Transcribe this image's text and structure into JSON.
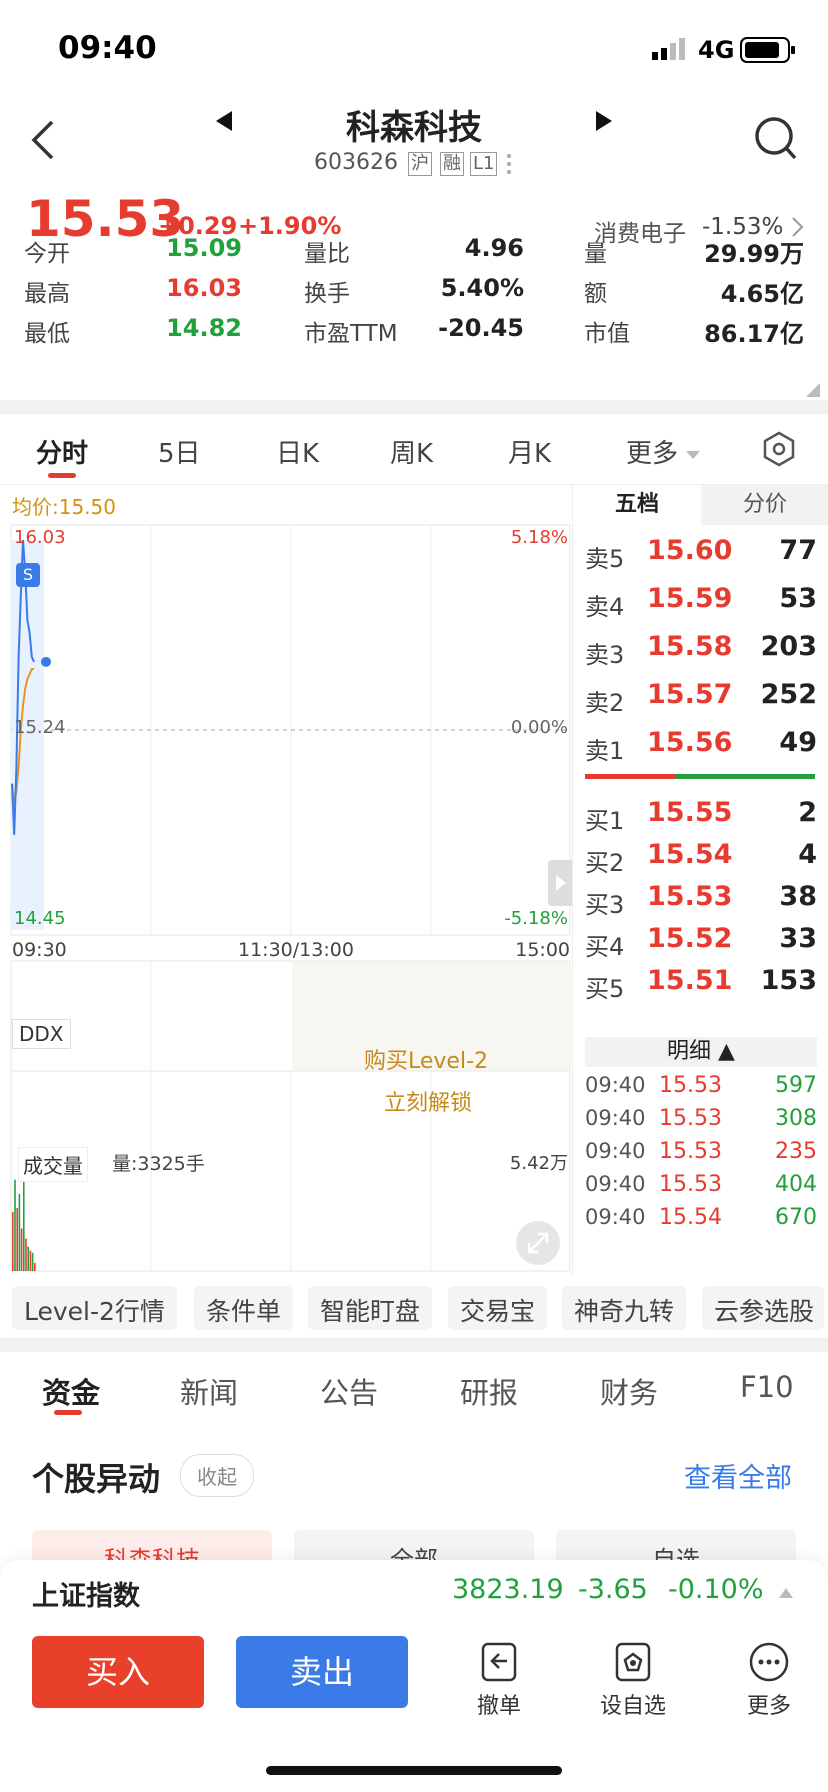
{
  "status_bar": {
    "time": "09:40",
    "network": "4G"
  },
  "header": {
    "title": "科森科技",
    "code": "603626",
    "badges": [
      "沪",
      "融",
      "L1"
    ]
  },
  "quote": {
    "price": "15.53",
    "change": "+0.29",
    "change_pct": "+1.90%",
    "sector_name": "消费电子",
    "sector_pct": "-1.53%",
    "stats": [
      {
        "label": "今开",
        "value": "15.09",
        "color": "green"
      },
      {
        "label": "量比",
        "value": "4.96",
        "color": "dark"
      },
      {
        "label": "量",
        "value": "29.99万",
        "color": "dark"
      },
      {
        "label": "最高",
        "value": "16.03",
        "color": "red"
      },
      {
        "label": "换手",
        "value": "5.40%",
        "color": "dark"
      },
      {
        "label": "额",
        "value": "4.65亿",
        "color": "dark"
      },
      {
        "label": "最低",
        "value": "14.82",
        "color": "green"
      },
      {
        "label": "市盈TTM",
        "value": "-20.45",
        "color": "dark"
      },
      {
        "label": "市值",
        "value": "86.17亿",
        "color": "dark"
      }
    ]
  },
  "chart_tabs": [
    "分时",
    "5日",
    "日K",
    "周K",
    "月K",
    "更多"
  ],
  "intraday": {
    "avg_label": "均价:15.50",
    "y_top": "16.03",
    "y_mid": "15.24",
    "y_bot": "14.45",
    "pct_top": "5.18%",
    "pct_mid": "0.00%",
    "pct_bot": "-5.18%",
    "time_start": "09:30",
    "time_mid": "11:30/13:00",
    "time_end": "15:00",
    "ddx_label": "DDX",
    "level2_promo_line1": "购买Level-2",
    "level2_promo_line2": "立刻解锁",
    "volume_label": "成交量",
    "volume_value": "量:3325手",
    "volume_max": "5.42万",
    "marker_label": "S"
  },
  "chart_data": {
    "type": "line",
    "x": [
      "09:30",
      "09:31",
      "09:32",
      "09:33",
      "09:34",
      "09:35",
      "09:36",
      "09:37",
      "09:38",
      "09:39",
      "09:40"
    ],
    "series": [
      {
        "values": [
          15.03,
          14.82,
          15.1,
          15.55,
          15.8,
          16.03,
          15.9,
          15.7,
          15.65,
          15.55,
          15.53
        ]
      },
      {
        "values": [
          15.03,
          14.95,
          15.0,
          15.1,
          15.25,
          15.35,
          15.42,
          15.46,
          15.48,
          15.5,
          15.5
        ]
      }
    ],
    "volume": [
      2.9,
      4.5,
      3.1,
      3.8,
      2.1,
      5.42,
      1.6,
      1.2,
      1.0,
      0.9,
      0.4
    ],
    "ylim": [
      14.45,
      16.03
    ],
    "xlim": [
      "09:30",
      "15:00"
    ]
  },
  "book": {
    "tabs": [
      "五档",
      "分价"
    ],
    "asks": [
      {
        "label": "卖5",
        "price": "15.60",
        "vol": "77"
      },
      {
        "label": "卖4",
        "price": "15.59",
        "vol": "53"
      },
      {
        "label": "卖3",
        "price": "15.58",
        "vol": "203"
      },
      {
        "label": "卖2",
        "price": "15.57",
        "vol": "252"
      },
      {
        "label": "卖1",
        "price": "15.56",
        "vol": "49"
      }
    ],
    "bids": [
      {
        "label": "买1",
        "price": "15.55",
        "vol": "2"
      },
      {
        "label": "买2",
        "price": "15.54",
        "vol": "4"
      },
      {
        "label": "买3",
        "price": "15.53",
        "vol": "38"
      },
      {
        "label": "买4",
        "price": "15.52",
        "vol": "33"
      },
      {
        "label": "买5",
        "price": "15.51",
        "vol": "153"
      }
    ],
    "detail_label": "明细",
    "ticks": [
      {
        "time": "09:40",
        "price": "15.53",
        "vol": "597",
        "color": "green"
      },
      {
        "time": "09:40",
        "price": "15.53",
        "vol": "308",
        "color": "green"
      },
      {
        "time": "09:40",
        "price": "15.53",
        "vol": "235",
        "color": "red"
      },
      {
        "time": "09:40",
        "price": "15.53",
        "vol": "404",
        "color": "green"
      },
      {
        "time": "09:40",
        "price": "15.54",
        "vol": "670",
        "color": "green"
      }
    ]
  },
  "tools": [
    "Level-2行情",
    "条件单",
    "智能盯盘",
    "交易宝",
    "神奇九转",
    "云参选股"
  ],
  "info_tabs": [
    "资金",
    "新闻",
    "公告",
    "研报",
    "财务",
    "F10"
  ],
  "anomaly": {
    "title": "个股异动",
    "collapse": "收起",
    "view_all": "查看全部",
    "filters": [
      "科森科技",
      "全部",
      "自选"
    ]
  },
  "index_bar": {
    "name": "上证指数",
    "value": "3823.19",
    "change": "-3.65",
    "pct": "-0.10%"
  },
  "actions": {
    "buy": "买入",
    "sell": "卖出",
    "cancel": "撤单",
    "watch": "设自选",
    "more": "更多"
  }
}
